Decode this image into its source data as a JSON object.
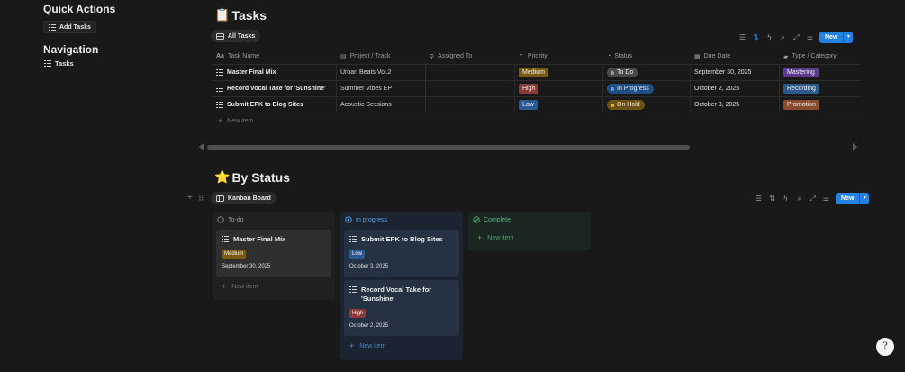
{
  "sidebar": {
    "quick_actions_title": "Quick Actions",
    "add_tasks_label": "Add Tasks",
    "navigation_title": "Navigation",
    "nav_tasks_label": "Tasks"
  },
  "tasks_section": {
    "emoji": "📋",
    "title": "Tasks",
    "view_label": "All Tasks",
    "new_label": "New",
    "columns": [
      "Task Name",
      "Project / Track",
      "Assigned To",
      "Priority",
      "Status",
      "Due Date",
      "Type / Category"
    ],
    "rows": [
      {
        "name": "Master Final Mix",
        "project": "Urban Beats Vol.2",
        "assigned": "",
        "priority": "Medium",
        "status": "To Do",
        "due": "September 30, 2025",
        "type": "Mastering"
      },
      {
        "name": "Record Vocal Take for 'Sunshine'",
        "project": "Summer Vibes EP",
        "assigned": "",
        "priority": "High",
        "status": "In Progress",
        "due": "October 2, 2025",
        "type": "Recording"
      },
      {
        "name": "Submit EPK to Blog Sites",
        "project": "Acoustic Sessions",
        "assigned": "",
        "priority": "Low",
        "status": "On Hold",
        "due": "October 3, 2025",
        "type": "Promotion"
      }
    ],
    "new_item_label": "New item"
  },
  "status_section": {
    "emoji": "⭐",
    "title": "By Status",
    "view_label": "Kanban Board",
    "new_label": "New",
    "groups": {
      "todo": {
        "label": "To-do",
        "cards": [
          {
            "title": "Master Final Mix",
            "priority": "Medium",
            "date": "September 30, 2025"
          }
        ],
        "new_item_label": "New item"
      },
      "progress": {
        "label": "In progress",
        "cards": [
          {
            "title": "Submit EPK to Blog Sites",
            "priority": "Low",
            "date": "October 3, 2025"
          },
          {
            "title": "Record Vocal Take for 'Sunshine'",
            "priority": "High",
            "date": "October 2, 2025"
          }
        ],
        "new_item_label": "New item"
      },
      "complete": {
        "label": "Complete",
        "new_item_label": "New item"
      }
    }
  },
  "help_label": "?",
  "colors": {
    "accent": "#2383e2",
    "medium": "#7a5a12",
    "high": "#8a3a36",
    "low": "#2b5a92",
    "todo_status": "#4a4a4a",
    "progress_status": "#1f4e86",
    "onhold_status": "#6c5210",
    "mastering": "#5b3b8c",
    "recording": "#2a5a8c",
    "promotion": "#8a4a2c"
  },
  "icons": {
    "task_list": "task-list-icon",
    "filter": "filter-icon",
    "sort": "sort-icon",
    "bolt": "automation-icon",
    "search": "search-icon",
    "expand": "expand-icon",
    "settings": "settings-icon"
  }
}
